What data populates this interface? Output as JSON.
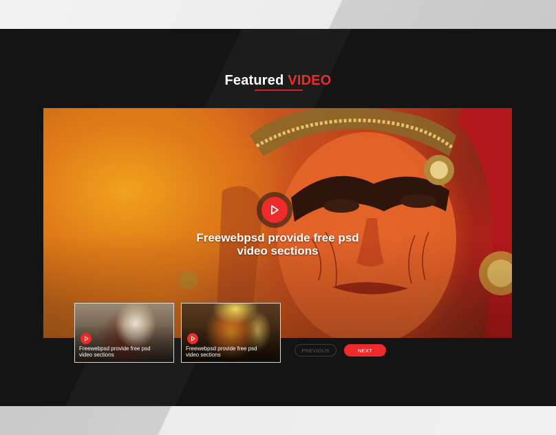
{
  "section": {
    "title_white": "Featured",
    "title_red": "VIDEO"
  },
  "hero": {
    "caption_line1": "Freewebpsd provide free psd",
    "caption_line2": "video sections",
    "play_icon": "play-icon"
  },
  "thumbnails": [
    {
      "caption_line1": "Freewebpsd provide free psd",
      "caption_line2": "video sections",
      "play_icon": "play-icon"
    },
    {
      "caption_line1": "Freewebpsd provide free psd",
      "caption_line2": "video sections",
      "play_icon": "play-icon"
    }
  ],
  "pager": {
    "previous_label": "PREVIOUS",
    "next_label": "NEXT"
  },
  "colors": {
    "accent": "#ee2a2a",
    "background": "#141414",
    "text": "#ffffff"
  }
}
